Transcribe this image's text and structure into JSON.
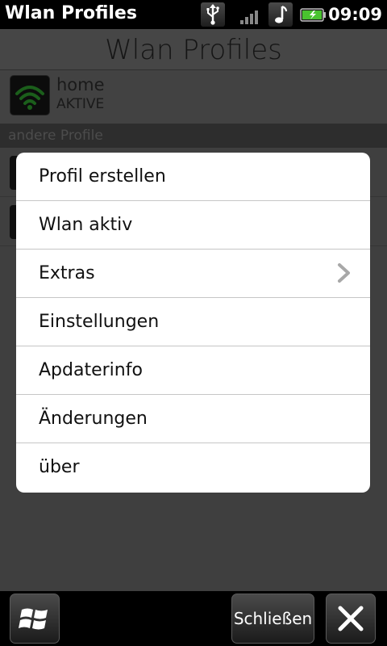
{
  "status_bar": {
    "app_title": "Wlan Profiles",
    "time": "09:09",
    "icons": [
      "usb-icon",
      "signal-icon",
      "music-icon",
      "battery-icon"
    ]
  },
  "header": {
    "title": "Wlan Profiles"
  },
  "active_profile": {
    "name": "home",
    "status": "AKTIVE",
    "icon": "wifi-icon"
  },
  "section": {
    "label": "andere Profile"
  },
  "menu": {
    "items": [
      {
        "label": "Profil erstellen"
      },
      {
        "label": "Wlan aktiv"
      },
      {
        "label": "Extras",
        "submenu": true
      },
      {
        "label": "Einstellungen"
      },
      {
        "label": "Apdaterinfo"
      },
      {
        "label": "Änderungen"
      },
      {
        "label": "über"
      }
    ]
  },
  "bottom_bar": {
    "start_icon": "windows-logo-icon",
    "close_label": "Schließen",
    "close_icon": "close-icon"
  },
  "colors": {
    "menu_bg": "#ffffff",
    "wifi_green": "#2fa82f",
    "battery_green": "#49c32f"
  }
}
